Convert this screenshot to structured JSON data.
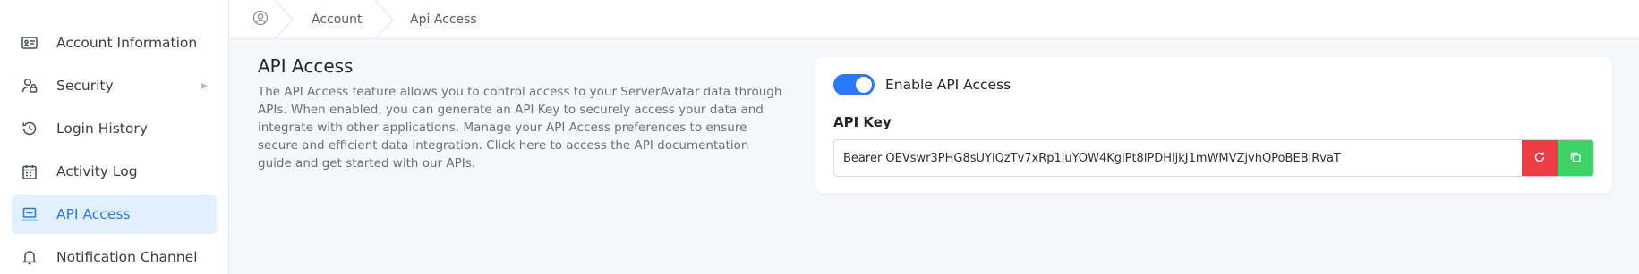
{
  "sidebar": {
    "items": [
      {
        "label": "Account Information",
        "icon": "id-card-icon",
        "active": false
      },
      {
        "label": "Security",
        "icon": "user-lock-icon",
        "active": false,
        "has_submenu": true
      },
      {
        "label": "Login History",
        "icon": "history-icon",
        "active": false
      },
      {
        "label": "Activity Log",
        "icon": "calendar-list-icon",
        "active": false
      },
      {
        "label": "API Access",
        "icon": "laptop-icon",
        "active": true
      },
      {
        "label": "Notification Channel",
        "icon": "bell-icon",
        "active": false
      }
    ]
  },
  "breadcrumb": {
    "home_icon": "user-circle-icon",
    "items": [
      "Account",
      "Api Access"
    ]
  },
  "main": {
    "title": "API Access",
    "description": "The API Access feature allows you to control access to your ServerAvatar data through APIs. When enabled, you can generate an API Key to securely access your data and integrate with other applications. Manage your API Access preferences to ensure secure and efficient data integration. Click here to access the API documentation guide and get started with our APIs."
  },
  "api_card": {
    "toggle_label": "Enable API Access",
    "toggle_on": true,
    "key_label": "API Key",
    "key_value": "Bearer OEVswr3PHG8sUYlQzTv7xRp1iuYOW4KglPt8lPDHljkJ1mWMVZjvhQPoBEBiRvaT",
    "regenerate_icon": "refresh-icon",
    "copy_icon": "copy-icon"
  },
  "colors": {
    "accent": "#2a78e4",
    "active_bg": "#e2efff",
    "toggle_on": "#2979ff",
    "danger": "#ef3b43",
    "success": "#3ed163"
  }
}
